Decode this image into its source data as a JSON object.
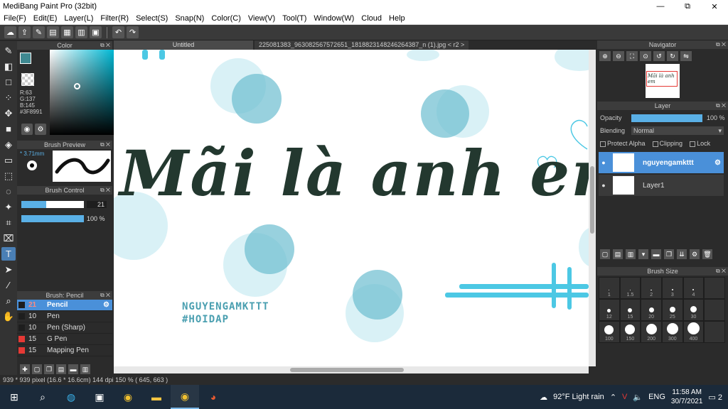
{
  "app": {
    "title": "MediBang Paint Pro (32bit)"
  },
  "window_controls": [
    "—",
    "⧉",
    "✕"
  ],
  "menu": [
    "File(F)",
    "Edit(E)",
    "Layer(L)",
    "Filter(R)",
    "Select(S)",
    "Snap(N)",
    "Color(C)",
    "View(V)",
    "Tool(T)",
    "Window(W)",
    "Cloud",
    "Help"
  ],
  "color_panel": {
    "title": "Color",
    "r": "R:63",
    "g": "G:137",
    "b": "B:145",
    "hex": "#3F8991",
    "accent": "#3f8991"
  },
  "brush_preview": {
    "title": "Brush Preview",
    "size": "* 3.71mm"
  },
  "brush_control": {
    "title": "Brush Control",
    "size_value": "21",
    "opacity_value": "100 %",
    "size_fraction": 0.4,
    "opacity_fraction": 1.0
  },
  "brush_list": {
    "title": "Brush: Pencil",
    "items": [
      {
        "size": "21",
        "name": "Pencil",
        "active": true,
        "swatch": "dark"
      },
      {
        "size": "10",
        "name": "Pen",
        "active": false,
        "swatch": "dark"
      },
      {
        "size": "10",
        "name": "Pen (Sharp)",
        "active": false,
        "swatch": "dark"
      },
      {
        "size": "15",
        "name": "G Pen",
        "active": false,
        "swatch": "red"
      },
      {
        "size": "15",
        "name": "Mapping Pen",
        "active": false,
        "swatch": "red"
      }
    ]
  },
  "tabs": [
    "Untitled",
    "225081383_963082567572651_1818823148246264387_n (1).jpg < r2 >"
  ],
  "canvas": {
    "title": "Mãi là anh em",
    "watermark_line1": "NGUYENGAMKTTT",
    "watermark_line2": "#HOIDAP"
  },
  "status": "939 * 939 pixel   (16.6 * 16.6cm)   144 dpi   150 %   ( 645, 663 )",
  "navigator": {
    "title": "Navigator",
    "thumb_text": "Mãi là anh em"
  },
  "layer_panel": {
    "title": "Layer",
    "opacity_label": "Opacity",
    "opacity_value": "100 %",
    "blending_label": "Blending",
    "blending_value": "Normal",
    "protect_alpha": "Protect Alpha",
    "clipping": "Clipping",
    "lock": "Lock",
    "layers": [
      {
        "name": "nguyengamkttt",
        "active": true
      },
      {
        "name": "Layer1",
        "active": false
      }
    ]
  },
  "brush_size": {
    "title": "Brush Size",
    "sizes": [
      "1",
      "1.5",
      "2",
      "3",
      "4",
      "",
      "12",
      "15",
      "20",
      "25",
      "30",
      "",
      "100",
      "150",
      "200",
      "300",
      "400",
      ""
    ]
  },
  "taskbar": {
    "weather": "92°F  Light rain",
    "lang": "ENG",
    "time": "11:58 AM",
    "date": "30/7/2021",
    "notif_count": "2"
  }
}
